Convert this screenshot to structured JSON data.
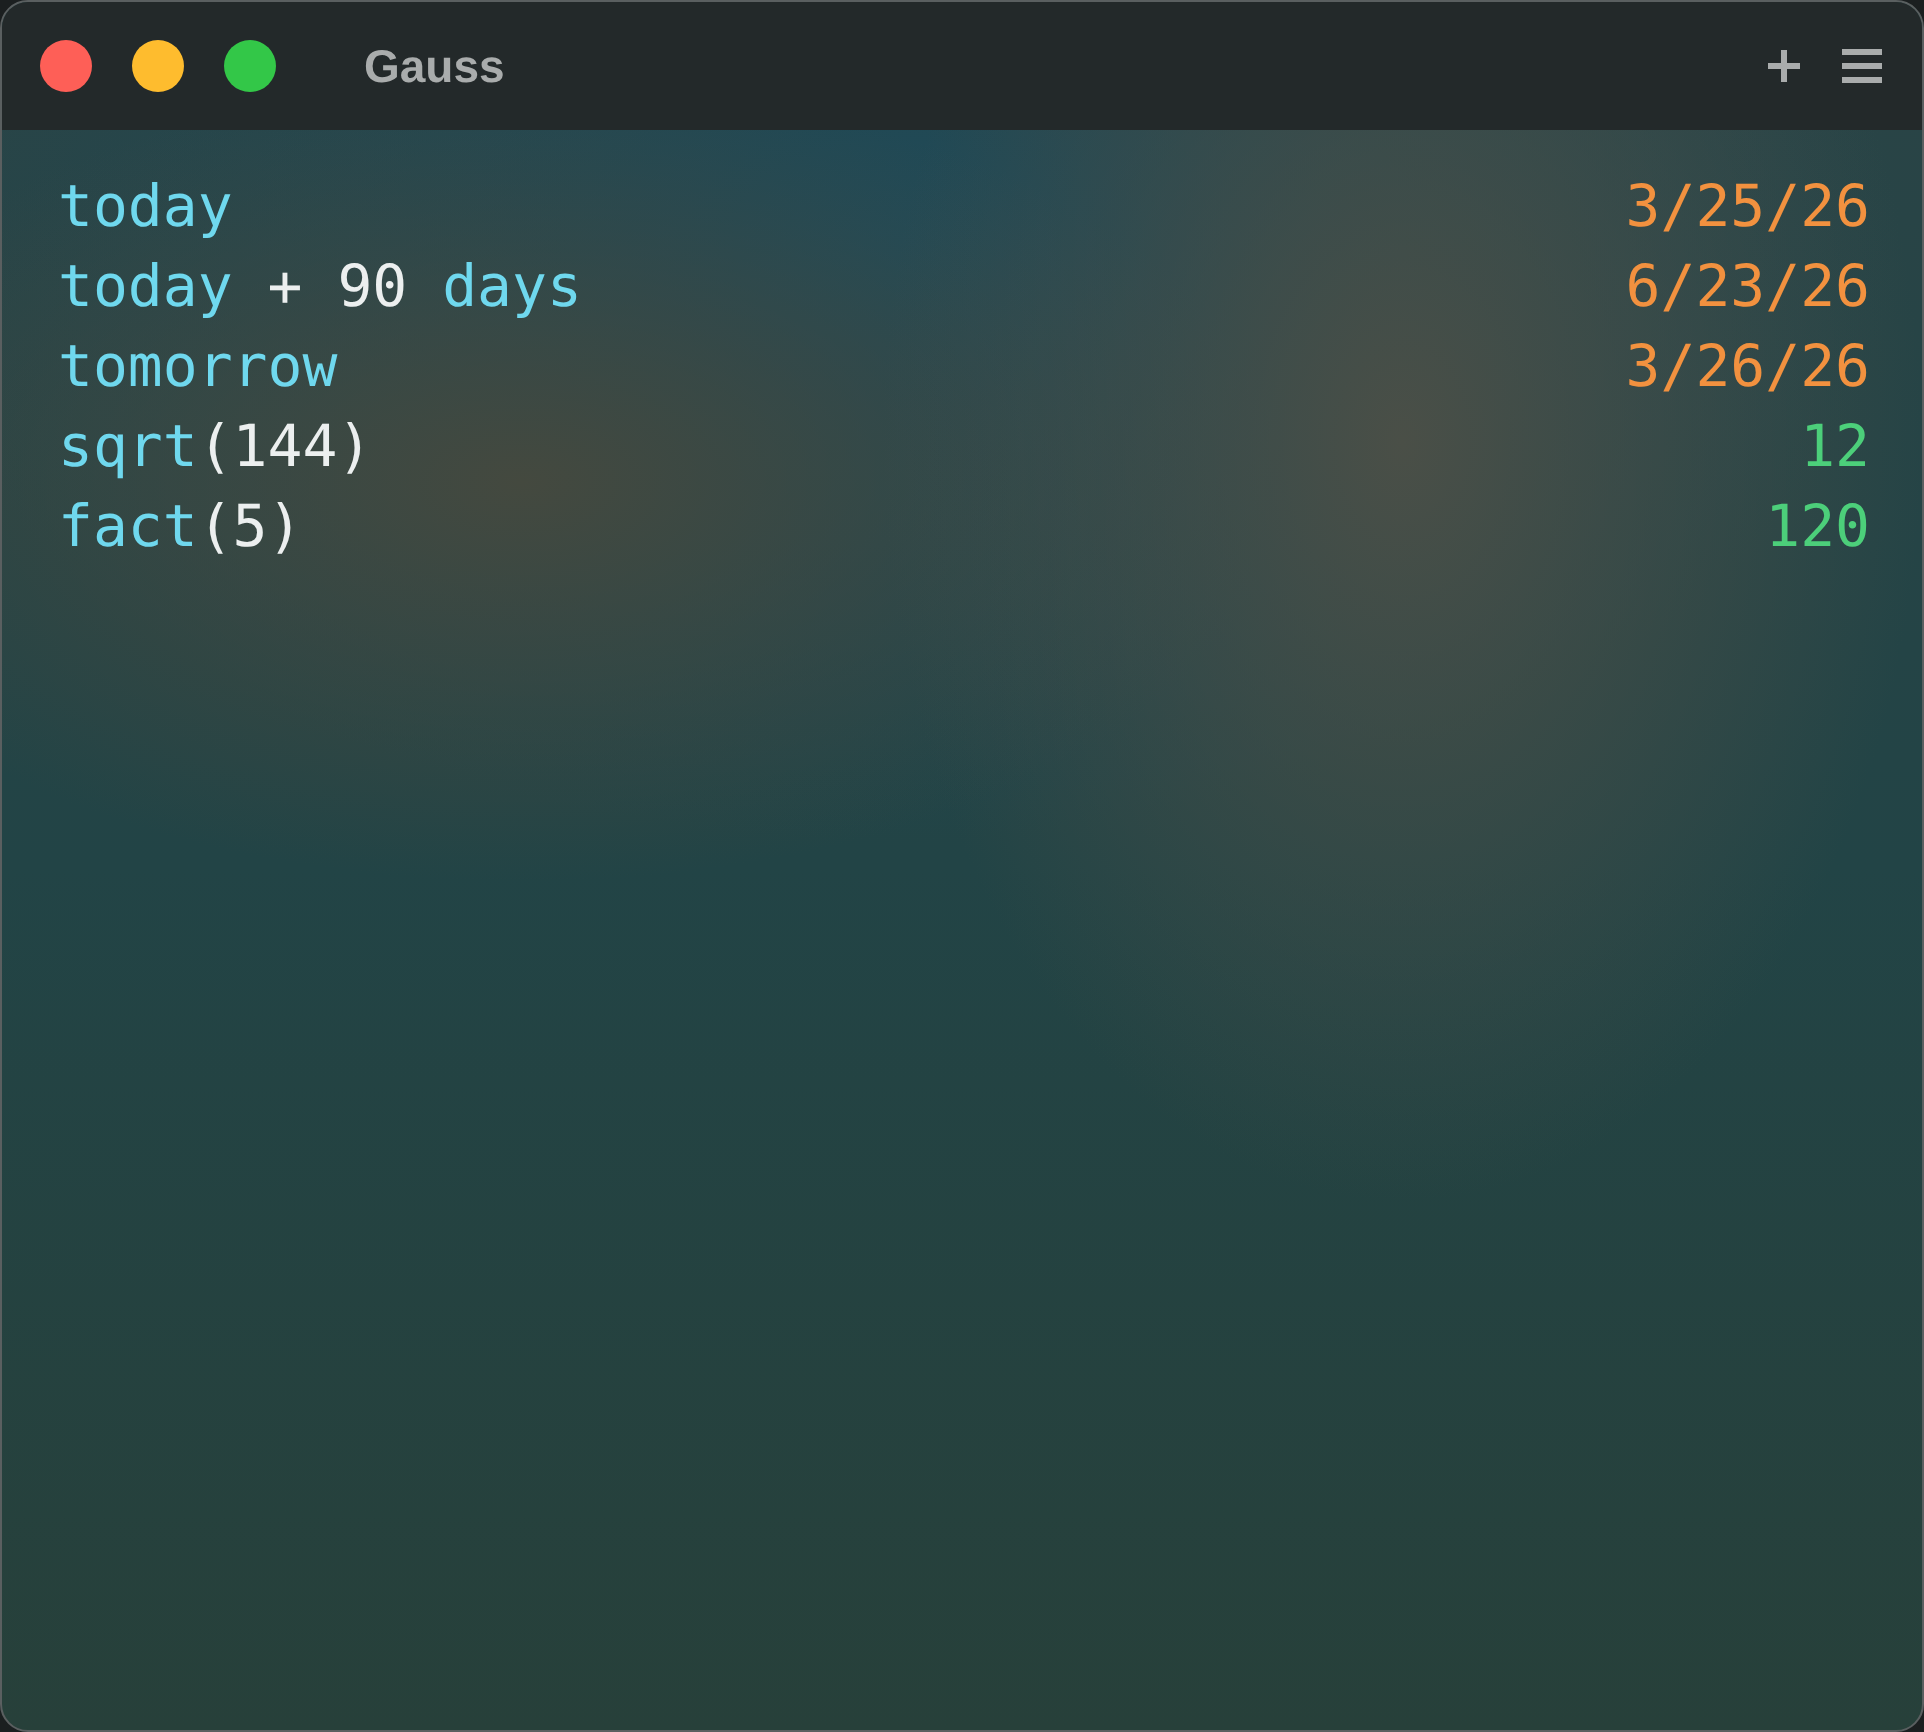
{
  "window": {
    "title": "Gauss"
  },
  "lines": [
    {
      "expression": [
        {
          "kind": "name",
          "text": "today"
        }
      ],
      "result": {
        "kind": "date",
        "text": "3/25/26"
      }
    },
    {
      "expression": [
        {
          "kind": "name",
          "text": "today"
        },
        {
          "kind": "literal",
          "text": " + 90 "
        },
        {
          "kind": "name",
          "text": "days"
        }
      ],
      "result": {
        "kind": "date",
        "text": "6/23/26"
      }
    },
    {
      "expression": [
        {
          "kind": "name",
          "text": "tomorrow"
        }
      ],
      "result": {
        "kind": "date",
        "text": "3/26/26"
      }
    },
    {
      "expression": [
        {
          "kind": "name",
          "text": "sqrt"
        },
        {
          "kind": "literal",
          "text": "(144)"
        }
      ],
      "result": {
        "kind": "number",
        "text": "12"
      }
    },
    {
      "expression": [
        {
          "kind": "name",
          "text": "fact"
        },
        {
          "kind": "literal",
          "text": "(5)"
        }
      ],
      "result": {
        "kind": "number",
        "text": "120"
      }
    }
  ]
}
